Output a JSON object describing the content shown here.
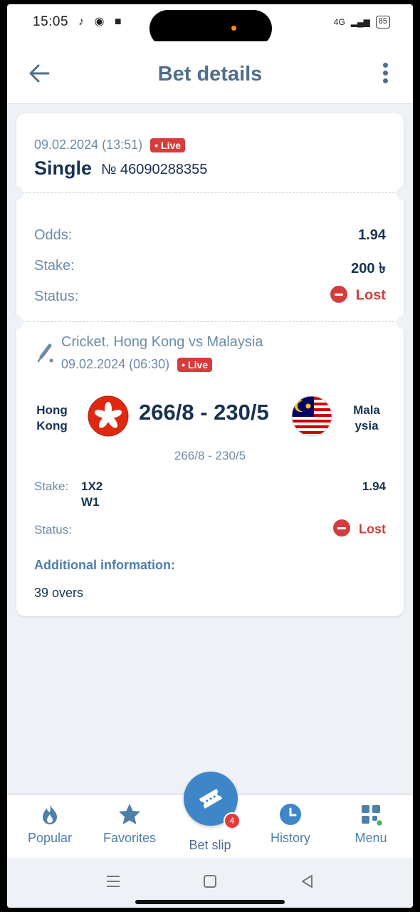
{
  "status_bar": {
    "time": "15:05",
    "battery": "85",
    "network": "4G"
  },
  "header": {
    "title": "Bet details",
    "back_icon": "arrow-left-icon",
    "menu_icon": "kebab-menu-icon"
  },
  "bet": {
    "date": "09.02.2024 (13:51)",
    "live_badge": "Live",
    "type": "Single",
    "number": "№ 46090288355",
    "odds_label": "Odds:",
    "odds_value": "1.94",
    "stake_label": "Stake:",
    "stake_value": "200 ৳",
    "status_label": "Status:",
    "status_value": "Lost"
  },
  "event": {
    "title": "Cricket. Hong Kong vs Malaysia",
    "date": "09.02.2024 (06:30)",
    "live_badge": "Live",
    "team1_line1": "Hong",
    "team1_line2": "Kong",
    "team2_line1": "Mala",
    "team2_line2": "ysia",
    "score": "266/8 - 230/5",
    "score_sub": "266/8 - 230/5",
    "stake_label": "Stake:",
    "market_line1": "1X2",
    "market_line2": "W1",
    "odds": "1.94",
    "status_label": "Status:",
    "status_value": "Lost",
    "additional_label": "Additional information:",
    "additional_value": "39 overs"
  },
  "nav": {
    "items": [
      {
        "label": "Popular",
        "icon": "flame-icon"
      },
      {
        "label": "Favorites",
        "icon": "star-icon"
      },
      {
        "label": "Bet slip",
        "icon": "ticket-icon"
      },
      {
        "label": "History",
        "icon": "clock-icon"
      },
      {
        "label": "Menu",
        "icon": "grid-icon"
      }
    ],
    "bet_slip_count": "4"
  },
  "colors": {
    "accent": "#3f86c9",
    "text_dark": "#173150",
    "muted": "#6d8aa6",
    "lost_red": "#d33d3d"
  }
}
